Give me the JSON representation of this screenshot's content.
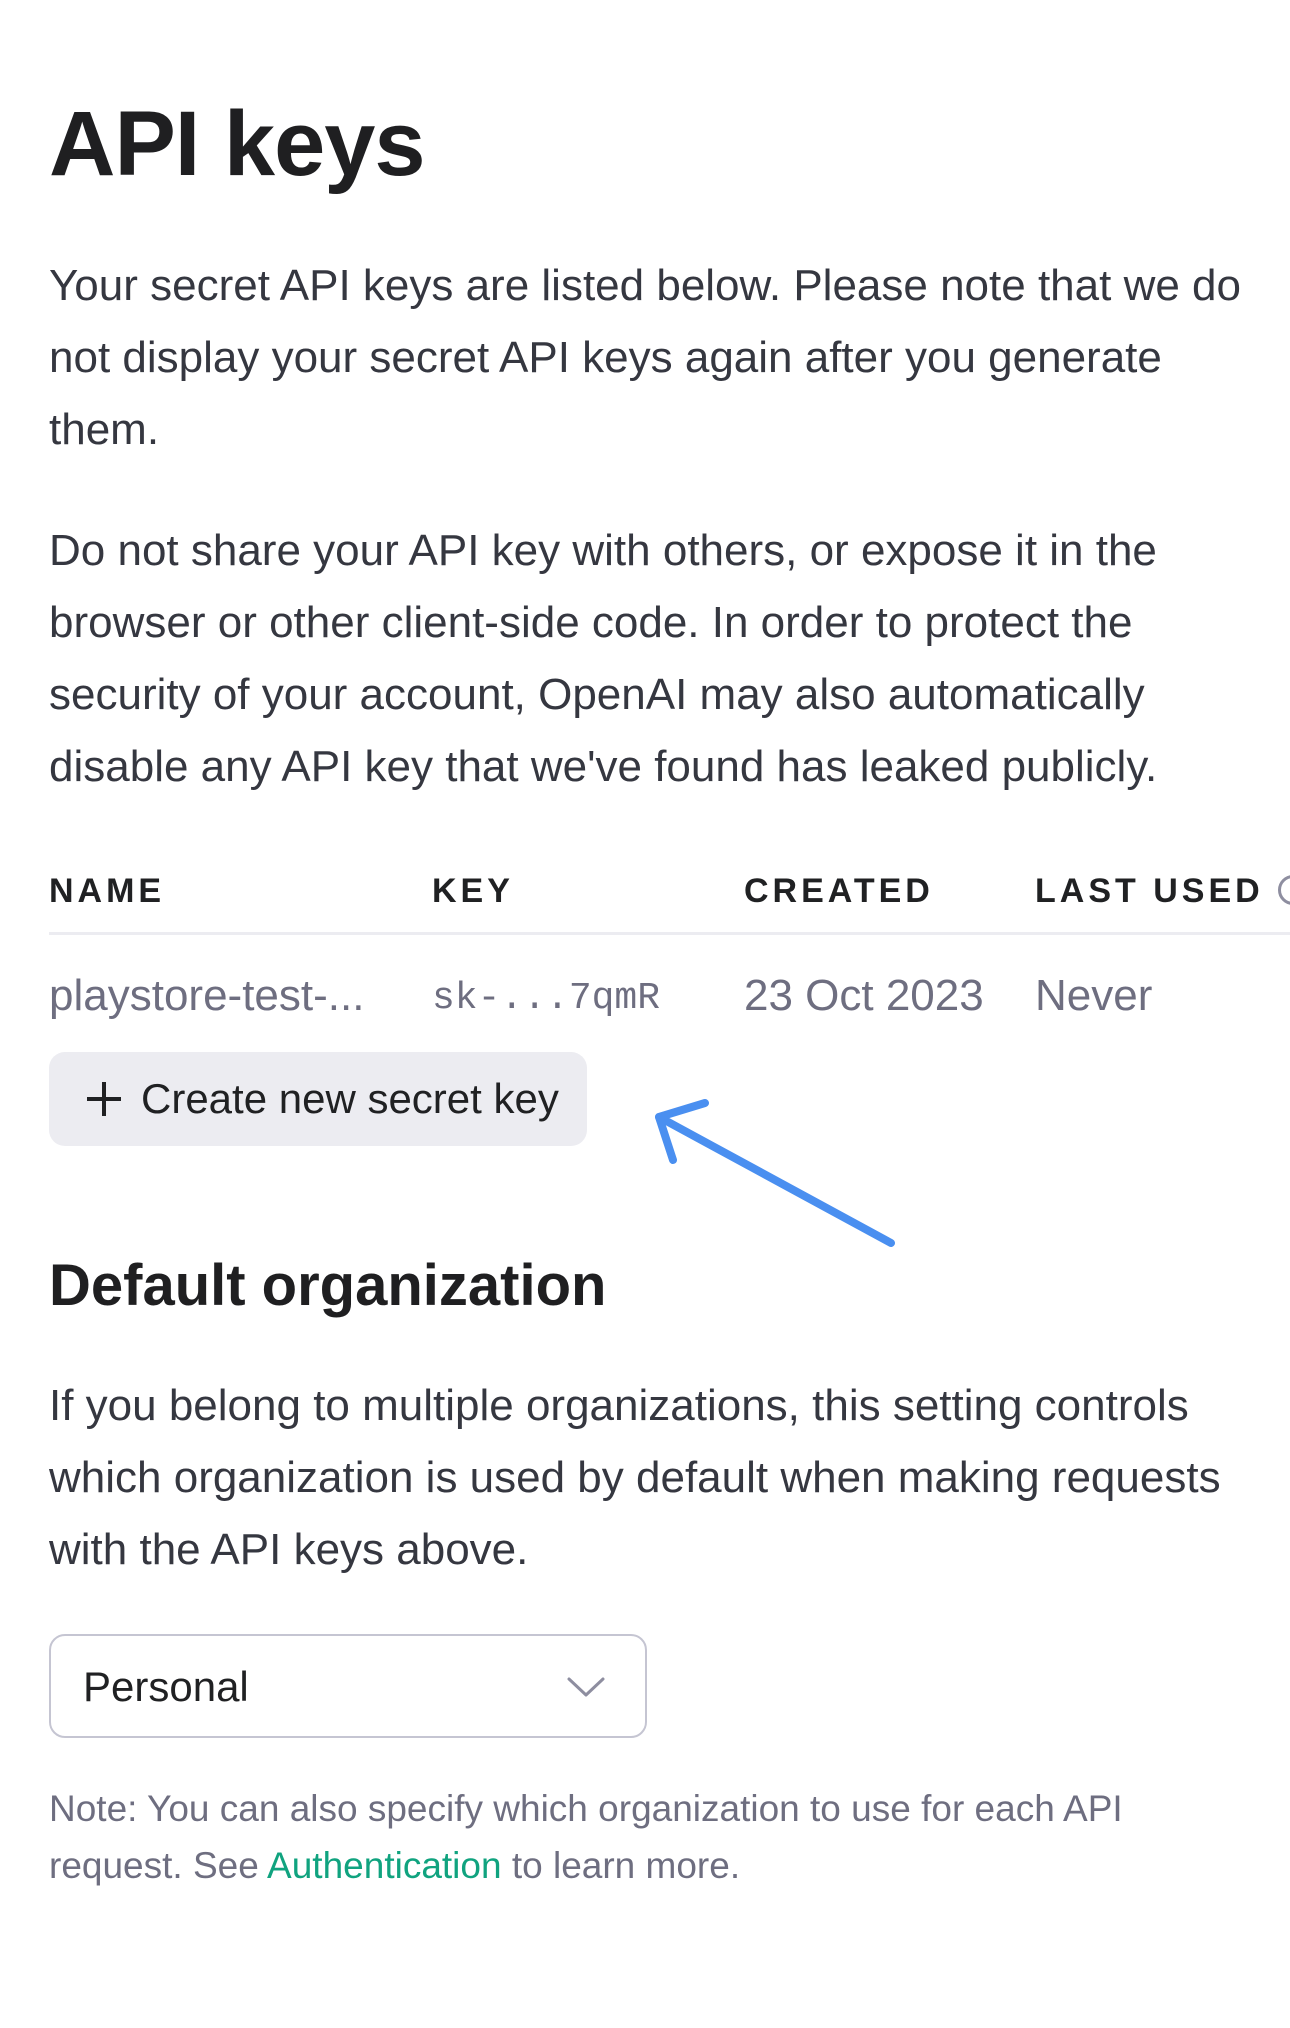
{
  "page": {
    "title": "API keys",
    "intro_paragraph": "Your secret API keys are listed below. Please note that we do not display your secret API keys again after you generate them.",
    "warning_paragraph": "Do not share your API key with others, or expose it in the browser or other client-side code. In order to protect the security of your account, OpenAI may also automatically disable any API key that we've found has leaked publicly."
  },
  "table": {
    "headers": {
      "name": "NAME",
      "key": "KEY",
      "created": "CREATED",
      "last_used": "LAST USED"
    },
    "rows": [
      {
        "name": "playstore-test-...",
        "key": "sk-...7qmR",
        "created": "23 Oct 2023",
        "last_used": "Never"
      }
    ]
  },
  "create_button": {
    "label": "Create new secret key",
    "icon": "plus-icon"
  },
  "annotation": {
    "arrow_color": "#4a8ff0"
  },
  "default_org": {
    "heading": "Default organization",
    "description": "If you belong to multiple organizations, this setting controls which organization is used by default when making requests with the API keys above.",
    "select_value": "Personal",
    "note_prefix": "Note: You can also specify which organization to use for each API request. See ",
    "note_link": "Authentication",
    "note_suffix": " to learn more."
  },
  "colors": {
    "link": "#10a37f",
    "button_bg": "#ececf1",
    "text_primary": "#202123",
    "text_muted": "#6e6e80"
  }
}
